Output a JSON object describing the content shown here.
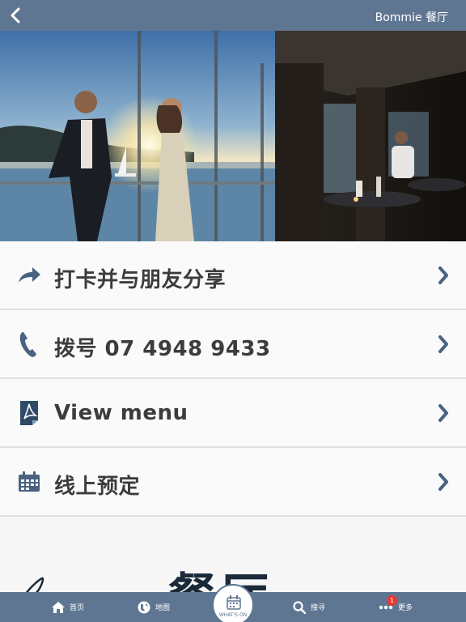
{
  "header": {
    "title": "Bommie 餐厅"
  },
  "menu": {
    "items": [
      {
        "label": "打卡并与朋友分享",
        "icon": "share-arrow-icon"
      },
      {
        "label": "拨号 07 4948 9433",
        "icon": "phone-icon"
      },
      {
        "label": "View menu",
        "icon": "pdf-document-icon"
      },
      {
        "label": "线上预定",
        "icon": "calendar-icon"
      }
    ]
  },
  "teaser": {
    "big_text": "餐厅"
  },
  "tabbar": {
    "home": "首页",
    "map": "地图",
    "whats_on": "WHAT'S ON",
    "search": "搜寻",
    "more": "更多",
    "more_badge": "1"
  },
  "colors": {
    "bar": "#5f7693",
    "icon": "#4a6280",
    "text": "#3c3c3c",
    "badge": "#e53935"
  }
}
